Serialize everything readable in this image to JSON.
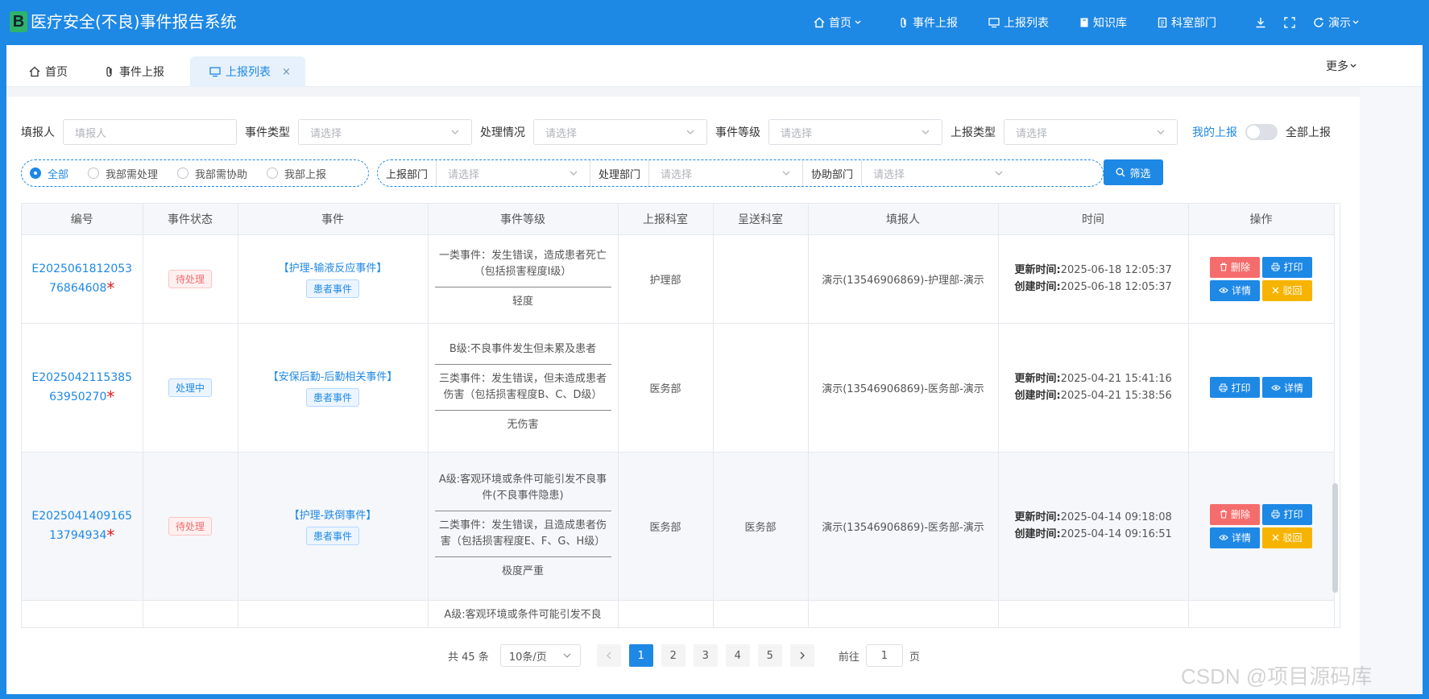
{
  "header": {
    "logo_letter": "B",
    "title": "医疗安全(不良)事件报告系统",
    "nav": [
      {
        "label": "首页",
        "icon": "home-icon",
        "has_caret": true
      },
      {
        "label": "事件上报",
        "icon": "paperclip-icon"
      },
      {
        "label": "上报列表",
        "icon": "monitor-icon"
      },
      {
        "label": "知识库",
        "icon": "book-icon"
      },
      {
        "label": "科室部门",
        "icon": "document-icon"
      }
    ],
    "user": "演示"
  },
  "tabs": [
    {
      "label": "首页",
      "icon": "home-icon"
    },
    {
      "label": "事件上报",
      "icon": "paperclip-icon"
    },
    {
      "label": "上报列表",
      "icon": "monitor-icon",
      "active": true,
      "close": "×"
    }
  ],
  "more_label": "更多",
  "filters": {
    "reporter": {
      "label": "填报人",
      "placeholder": "填报人"
    },
    "event_type": {
      "label": "事件类型",
      "placeholder": "请选择"
    },
    "handling": {
      "label": "处理情况",
      "placeholder": "请选择"
    },
    "event_level": {
      "label": "事件等级",
      "placeholder": "请选择"
    },
    "report_type": {
      "label": "上报类型",
      "placeholder": "请选择"
    },
    "my_reports": "我的上报",
    "all_reports": "全部上报",
    "scope": [
      "全部",
      "我部需处理",
      "我部需协助",
      "我部上报"
    ],
    "report_dept": {
      "label": "上报部门",
      "placeholder": "请选择"
    },
    "handle_dept": {
      "label": "处理部门",
      "placeholder": "请选择"
    },
    "assist_dept": {
      "label": "协助部门",
      "placeholder": "请选择"
    },
    "filter_button": "筛选"
  },
  "table": {
    "columns": [
      "编号",
      "事件状态",
      "事件",
      "事件等级",
      "上报科室",
      "呈送科室",
      "填报人",
      "时间",
      "操作"
    ],
    "rows": [
      {
        "code": "E202506181205376864608",
        "status": "待处理",
        "event": "【护理-输液反应事件】",
        "event_tag": "患者事件",
        "levels": [
          "一类事件：发生错误，造成患者死亡（包括损害程度Ⅰ级）",
          "轻度"
        ],
        "report_dept": "护理部",
        "send_dept": "",
        "reporter": "演示(13546906869)-护理部-演示",
        "updated_label": "更新时间:",
        "updated": "2025-06-18 12:05:37",
        "created_label": "创建时间:",
        "created": "2025-06-18 12:05:37",
        "ops": [
          "删除",
          "打印",
          "详情",
          "驳回"
        ]
      },
      {
        "code": "E202504211538563950270",
        "status": "处理中",
        "event": "【安保后勤-后勤相关事件】",
        "event_tag": "患者事件",
        "levels": [
          "B级:不良事件发生但未累及患者",
          "三类事件：发生错误，但未造成患者伤害（包括损害程度B、C、D级）",
          "无伤害"
        ],
        "report_dept": "医务部",
        "send_dept": "",
        "reporter": "演示(13546906869)-医务部-演示",
        "updated_label": "更新时间:",
        "updated": "2025-04-21 15:41:16",
        "created_label": "创建时间:",
        "created": "2025-04-21 15:38:56",
        "ops": [
          "打印",
          "详情"
        ]
      },
      {
        "code": "E202504140916513794934",
        "status": "待处理",
        "event": "【护理-跌倒事件】",
        "event_tag": "患者事件",
        "levels": [
          "A级:客观环境或条件可能引发不良事件(不良事件隐患)",
          "二类事件：发生错误，且造成患者伤害（包括损害程度E、F、G、H级）",
          "极度严重"
        ],
        "report_dept": "医务部",
        "send_dept": "医务部",
        "reporter": "演示(13546906869)-医务部-演示",
        "updated_label": "更新时间:",
        "updated": "2025-04-14 09:18:08",
        "created_label": "创建时间:",
        "created": "2025-04-14 09:16:51",
        "ops": [
          "删除",
          "打印",
          "详情",
          "驳回"
        ]
      },
      {
        "levels": [
          "A级:客观环境或条件可能引发不良"
        ]
      }
    ]
  },
  "pagination": {
    "total": "共 45 条",
    "page_size": "10条/页",
    "pages": [
      "1",
      "2",
      "3",
      "4",
      "5"
    ],
    "current": "1",
    "goto_prefix": "前往",
    "goto_value": "1",
    "goto_suffix": "页"
  },
  "watermark": "CSDN @项目源码库"
}
